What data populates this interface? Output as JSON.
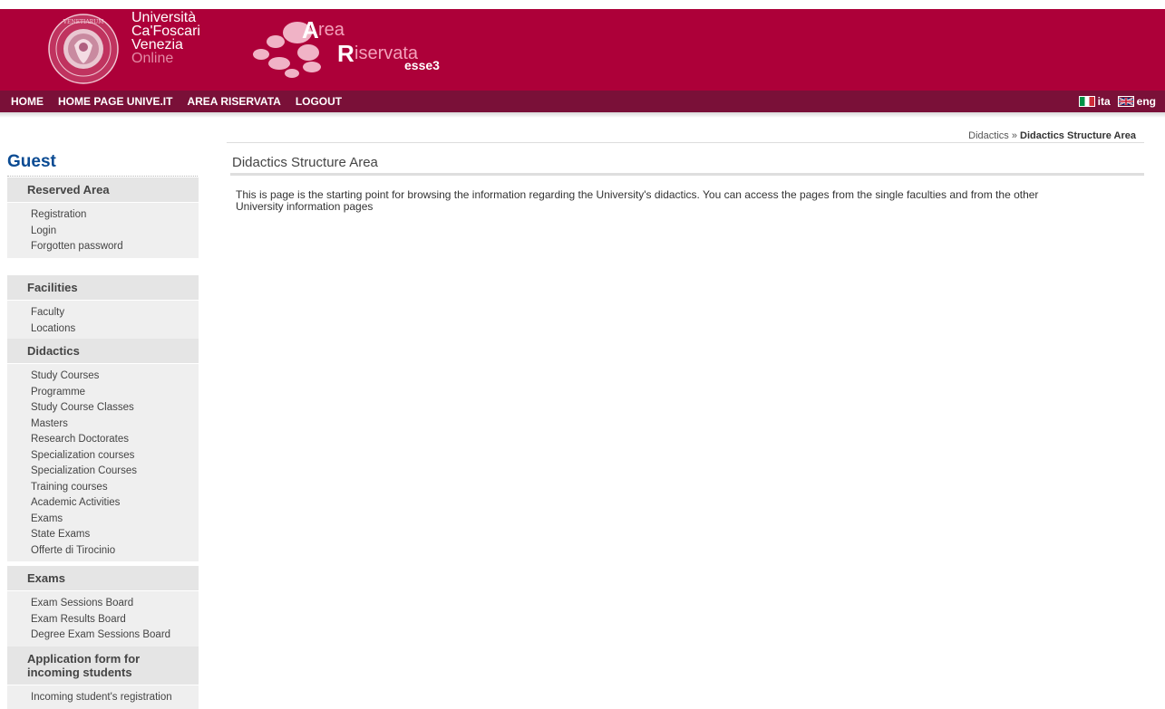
{
  "header": {
    "university_lines": [
      "Università",
      "Ca'Foscari",
      "Venezia"
    ],
    "online_label": "Online",
    "area_logo": {
      "a": "A",
      "rea": "rea",
      "r": "R",
      "iservata": "iservata",
      "esse3": "esse3"
    },
    "seal_icon": "university-seal-icon",
    "colors": {
      "brand": "#ad0039",
      "nav": "#7a1038",
      "accent_blue": "#0b4b93"
    }
  },
  "nav": {
    "items": [
      "HOME",
      "HOME PAGE UNIVE.IT",
      "AREA RISERVATA",
      "LOGOUT"
    ],
    "lang": [
      {
        "label": "ita",
        "icon": "italian-flag-icon"
      },
      {
        "label": "eng",
        "icon": "uk-flag-icon"
      }
    ]
  },
  "breadcrumb": {
    "parent": "Didactics",
    "separator": "»",
    "current": "Didactics Structure Area"
  },
  "sidebar": {
    "user": "Guest",
    "sections": [
      {
        "title": "Reserved Area",
        "items": [
          "Registration",
          "Login",
          "Forgotten password"
        ]
      },
      {
        "title": "Facilities",
        "items": [
          "Faculty",
          "Locations"
        ]
      },
      {
        "title": "Didactics",
        "items": [
          "Study Courses",
          "Programme",
          "Study Course Classes",
          "Masters",
          "Research Doctorates",
          "Specialization courses",
          "Specialization Courses",
          "Training courses",
          "Academic Activities",
          "Exams",
          "State Exams",
          "Offerte di Tirocinio"
        ]
      },
      {
        "title": "Exams",
        "items": [
          "Exam Sessions Board",
          "Exam Results Board",
          "Degree Exam Sessions Board"
        ]
      },
      {
        "title_lines": [
          "Application form for",
          "incoming students"
        ],
        "items": [
          "Incoming student's registration"
        ]
      }
    ]
  },
  "main": {
    "title": "Didactics Structure Area",
    "body_lines": [
      "This is page is the starting point for browsing the information regarding the University's didactics. You can access the pages from the single faculties and from the other",
      "University information pages"
    ]
  }
}
